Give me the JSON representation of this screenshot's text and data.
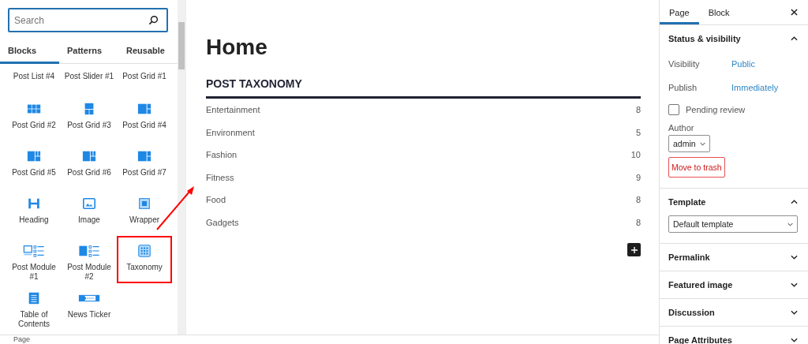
{
  "inserter": {
    "search": {
      "placeholder": "Search"
    },
    "tabs": [
      {
        "label": "Blocks",
        "selected": true
      },
      {
        "label": "Patterns",
        "selected": false
      },
      {
        "label": "Reusable",
        "selected": false
      }
    ],
    "blocks": [
      {
        "label": "Post List #4",
        "kind": "none",
        "highlighted": false
      },
      {
        "label": "Post Slider #1",
        "kind": "none",
        "highlighted": false
      },
      {
        "label": "Post Grid #1",
        "kind": "none",
        "highlighted": false
      },
      {
        "label": "Post Grid #2",
        "kind": "grid-columns",
        "highlighted": false
      },
      {
        "label": "Post Grid #3",
        "kind": "grid-stacked",
        "highlighted": false
      },
      {
        "label": "Post Grid #4",
        "kind": "grid-split",
        "highlighted": false
      },
      {
        "label": "Post Grid #5",
        "kind": "grid-mosaic",
        "highlighted": false
      },
      {
        "label": "Post Grid #6",
        "kind": "grid-mosaic",
        "highlighted": false
      },
      {
        "label": "Post Grid #7",
        "kind": "grid-split",
        "highlighted": false
      },
      {
        "label": "Heading",
        "kind": "heading",
        "highlighted": false
      },
      {
        "label": "Image",
        "kind": "image",
        "highlighted": false
      },
      {
        "label": "Wrapper",
        "kind": "wrapper",
        "highlighted": false
      },
      {
        "label": "Post Module #1",
        "kind": "module-outline",
        "highlighted": false
      },
      {
        "label": "Post Module #2",
        "kind": "module-filled",
        "highlighted": false
      },
      {
        "label": "Taxonomy",
        "kind": "taxonomy",
        "highlighted": true
      },
      {
        "label": "Table of Contents",
        "kind": "toc",
        "highlighted": false
      },
      {
        "label": "News Ticker",
        "kind": "ticker",
        "highlighted": false
      }
    ],
    "footer": "Page"
  },
  "editor": {
    "title": "Home",
    "block_title": "POST TAXONOMY",
    "terms": [
      {
        "name": "Entertainment",
        "count": "8"
      },
      {
        "name": "Environment",
        "count": "5"
      },
      {
        "name": "Fashion",
        "count": "10"
      },
      {
        "name": "Fitness",
        "count": "9"
      },
      {
        "name": "Food",
        "count": "8"
      },
      {
        "name": "Gadgets",
        "count": "8"
      }
    ]
  },
  "sidebar": {
    "tabs": [
      {
        "label": "Page",
        "selected": true
      },
      {
        "label": "Block",
        "selected": false
      }
    ],
    "sections": [
      {
        "title": "Status & visibility",
        "expanded": true,
        "kind": "status"
      },
      {
        "title": "Template",
        "expanded": true,
        "kind": "template"
      },
      {
        "title": "Permalink",
        "expanded": false,
        "kind": "plain"
      },
      {
        "title": "Featured image",
        "expanded": false,
        "kind": "plain"
      },
      {
        "title": "Discussion",
        "expanded": false,
        "kind": "plain"
      },
      {
        "title": "Page Attributes",
        "expanded": false,
        "kind": "plain"
      }
    ],
    "status": {
      "rows": [
        {
          "label": "Visibility",
          "value": "Public"
        },
        {
          "label": "Publish",
          "value": "Immediately"
        }
      ],
      "pending_review": {
        "label": "Pending review",
        "checked": false
      },
      "author": {
        "label": "Author",
        "value": "admin"
      },
      "trash": "Move to trash"
    },
    "template": {
      "value": "Default template"
    }
  }
}
